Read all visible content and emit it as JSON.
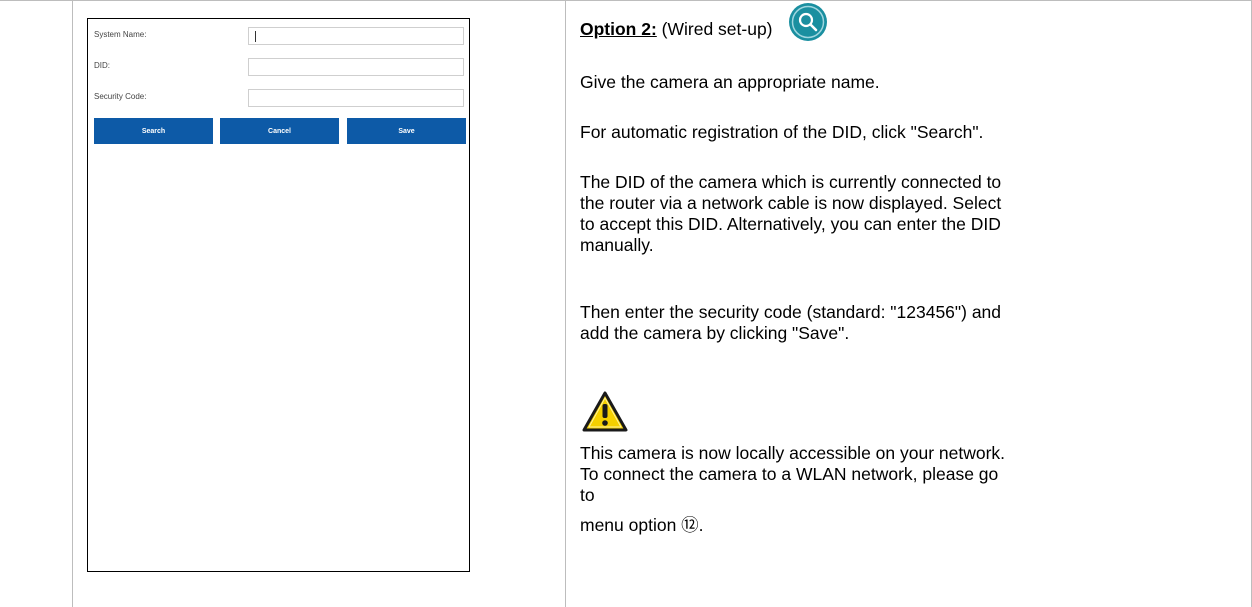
{
  "phone_form": {
    "system_name_label": "System Name:",
    "system_name_value": "",
    "did_label": "DID:",
    "did_value": "",
    "security_code_label": "Security Code:",
    "security_code_value": "",
    "buttons": {
      "search": "Search",
      "cancel": "Cancel",
      "save": "Save"
    }
  },
  "instructions": {
    "option_label": "Option 2:",
    "option_suffix": " (Wired set-up)",
    "para1": "Give the camera an appropriate name.",
    "para2": "For automatic registration of the DID, click \"Search\".",
    "para3_lines": [
      "The DID of the camera which is currently connected to",
      "the router via a network cable is now displayed. Select",
      "to accept this DID. Alternatively, you can enter the DID",
      "manually."
    ],
    "para4_lines": [
      "Then enter the security code (standard: \"123456\") and",
      "add the camera by clicking \"Save\"."
    ],
    "warning_lines": [
      "This camera is now locally accessible on your network.",
      "To connect the camera to a WLAN network, please go",
      "to",
      "menu option ⑫."
    ]
  },
  "colors": {
    "button_blue": "#0d5aa7",
    "icon_teal": "#1a8fa0",
    "warning_yellow": "#f5d000"
  },
  "icons": [
    "search-icon",
    "warning-icon"
  ]
}
